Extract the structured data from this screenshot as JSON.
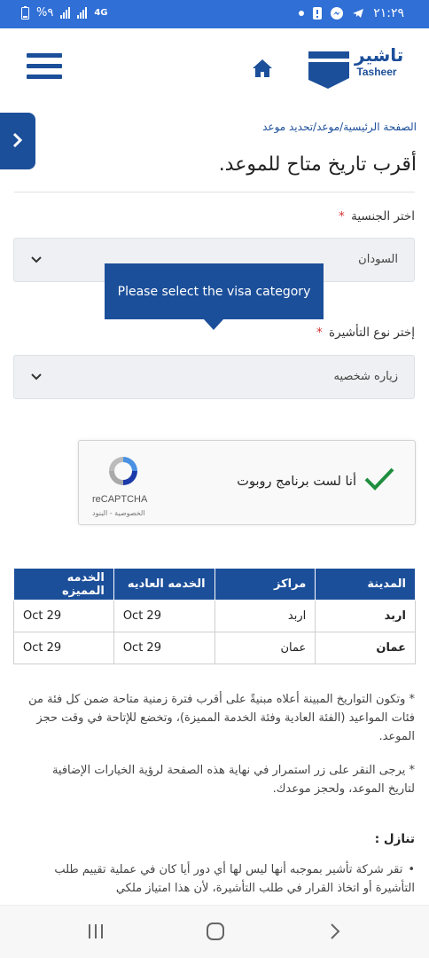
{
  "status_bar": {
    "time": "٢١:٢٩",
    "battery": "%٩",
    "network": "4G"
  },
  "header": {
    "logo_text_ar": "تاشير",
    "logo_text_en": "Tasheer"
  },
  "breadcrumb": "الصفحة الرئيسية/موعد/تحديد موعد",
  "page_title": "أقرب تاريخ متاح للموعد.",
  "nationality": {
    "label": "اختر الجنسية",
    "required_mark": "*",
    "value": "السودان"
  },
  "tooltip": "Please select the visa category",
  "visa_type": {
    "label": "إختر نوع التأشيرة",
    "required_mark": "*",
    "value": "زياره شخصيه"
  },
  "recaptcha": {
    "label": "أنا لست برنامج روبوت",
    "brand": "reCAPTCHA",
    "links": "الخصوصية - البنود"
  },
  "table": {
    "headers": {
      "city": "المدينة",
      "center": "مراكز",
      "regular": "الخدمه العاديه",
      "premium": "الخدمه المميزه"
    },
    "rows": [
      {
        "city": "اربد",
        "center": "اربد",
        "regular": "Oct 29",
        "premium": "Oct 29"
      },
      {
        "city": "عمان",
        "center": "عمان",
        "regular": "Oct 29",
        "premium": "Oct 29"
      }
    ]
  },
  "notes": [
    "* وتكون التواريخ المبينة أعلاه مبنيةً على أقرب فترة زمنية متاحة ضمن كل فئة من فئات المواعيد (الفئة العادية وفئة الخدمة المميزة)، وتخضع للإتاحة في وقت حجز الموعد.",
    "* يرجى النقر على زر استمرار في نهاية هذه الصفحة لرؤية الخيارات الإضافية لتاريخ الموعد، ولحجز موعدك."
  ],
  "disclaimer": {
    "title": "تنازل :",
    "text": "تقر شركة تأشير بموجبه أنها ليس لها أي دور أيا كان في عملية تقييم طلب التأشيرة أو اتخاذ القرار في طلب التأشيرة، لأن هذا امتياز ملكي"
  },
  "colors": {
    "primary": "#1c4f9a",
    "status_bar": "#2f6fd6",
    "check": "#1e8e3e"
  }
}
